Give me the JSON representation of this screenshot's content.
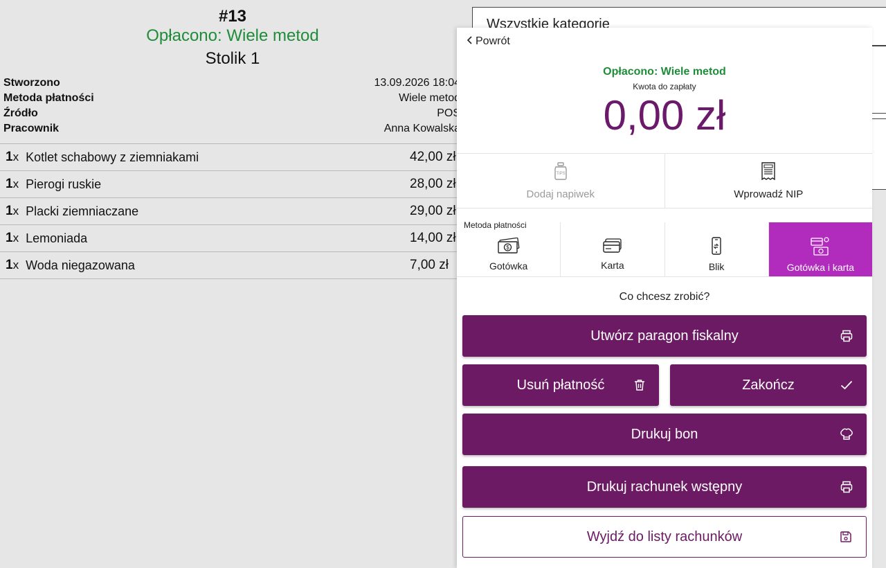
{
  "order": {
    "number": "#13",
    "status": "Opłacono: Wiele metod",
    "table": "Stolik 1",
    "meta": [
      {
        "label": "Stworzono",
        "value": "13.09.2026 18:04"
      },
      {
        "label": "Metoda płatności",
        "value": "Wiele metod"
      },
      {
        "label": "Źródło",
        "value": "POS"
      },
      {
        "label": "Pracownik",
        "value": "Anna Kowalska"
      }
    ],
    "items": [
      {
        "qty": "1",
        "unit": "x",
        "name": "Kotlet schabowy z ziemniakami",
        "price": "42,00 zł"
      },
      {
        "qty": "1",
        "unit": "x",
        "name": "Pierogi ruskie",
        "price": "28,00 zł"
      },
      {
        "qty": "1",
        "unit": "x",
        "name": "Placki ziemniaczane",
        "price": "29,00 zł"
      },
      {
        "qty": "1",
        "unit": "x",
        "name": "Lemoniada",
        "price": "14,00 zł"
      },
      {
        "qty": "1",
        "unit": "x",
        "name": "Woda niegazowana",
        "price": "7,00 zł"
      }
    ]
  },
  "background": {
    "category_label": "Wszystkie kategorie"
  },
  "modal": {
    "back_label": "Powrót",
    "status": "Opłacono: Wiele metod",
    "amount_label": "Kwota do zapłaty",
    "amount": "0,00 zł",
    "extras": {
      "tip": {
        "label": "Dodaj napiwek",
        "icon": "tips-jar-icon"
      },
      "nip": {
        "label": "Wprowadź NIP",
        "icon": "receipt-nip-icon"
      }
    },
    "payment_method_label": "Metoda płatności",
    "payment_methods": [
      {
        "label": "Gotówka",
        "icon": "cash-icon"
      },
      {
        "label": "Karta",
        "icon": "card-icon"
      },
      {
        "label": "Blik",
        "icon": "phone-icon"
      },
      {
        "label": "Gotówka i karta",
        "icon": "cash-and-card-icon",
        "active": true
      }
    ],
    "question": "Co chcesz zrobić?",
    "actions": {
      "fiscal": "Utwórz paragon fiskalny",
      "delete_payment": "Usuń płatność",
      "finish": "Zakończ",
      "print_ticket": "Drukuj bon",
      "print_prebill": "Drukuj rachunek wstępny",
      "exit": "Wyjdź do listy rachunków"
    },
    "colors": {
      "primary": "#6b1a63",
      "active_method": "#b12bbd",
      "paid_green": "#1f8c3a",
      "amount": "#6b1a6b"
    }
  }
}
